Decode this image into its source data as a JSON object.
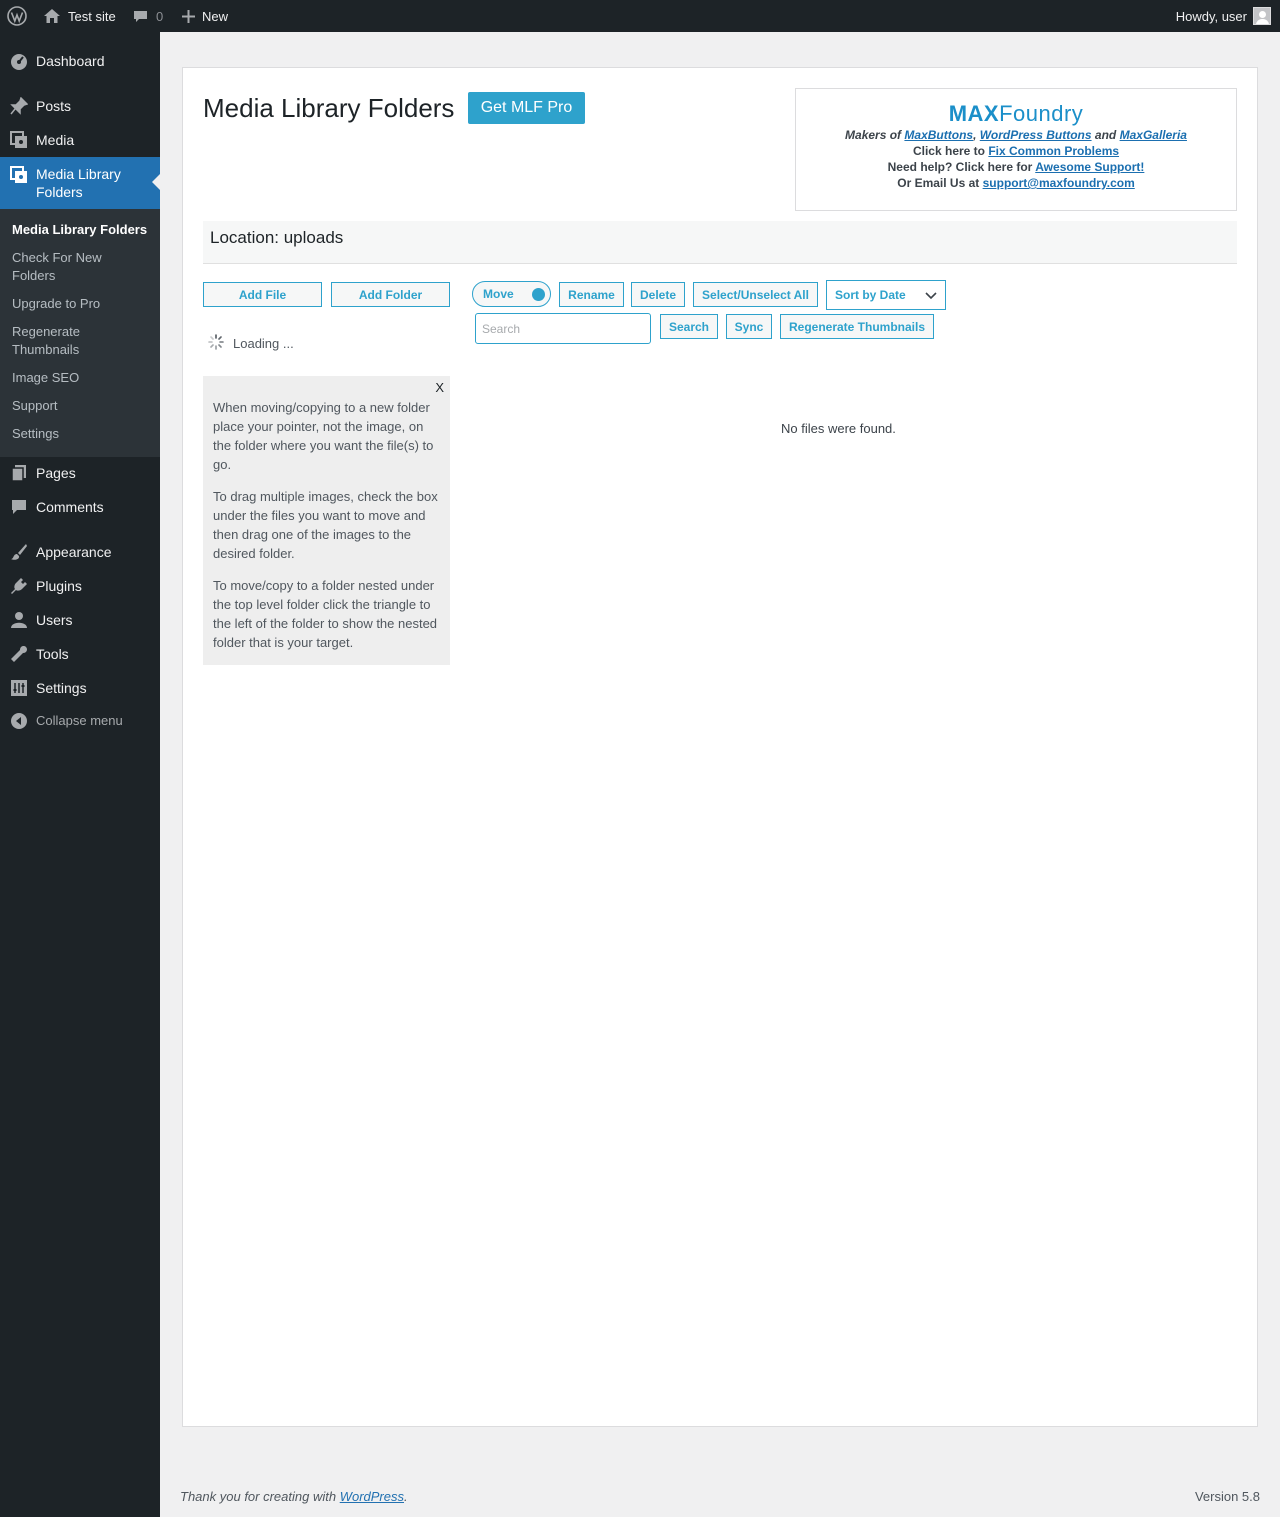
{
  "adminbar": {
    "site_name": "Test site",
    "comments_count": "0",
    "new_label": "New",
    "howdy": "Howdy, user"
  },
  "menu": {
    "dashboard": "Dashboard",
    "posts": "Posts",
    "media": "Media",
    "mlf": "Media Library Folders",
    "pages": "Pages",
    "comments": "Comments",
    "appearance": "Appearance",
    "plugins": "Plugins",
    "users": "Users",
    "tools": "Tools",
    "settings": "Settings",
    "collapse": "Collapse menu",
    "submenu": [
      "Media Library Folders",
      "Check For New Folders",
      "Upgrade to Pro",
      "Regenerate Thumbnails",
      "Image SEO",
      "Support",
      "Settings"
    ]
  },
  "page": {
    "title": "Media Library Folders",
    "get_pro": "Get MLF Pro",
    "location": "Location: uploads",
    "loading": "Loading ...",
    "no_files": "No files were found."
  },
  "maxbox": {
    "logo_max": "MAX",
    "logo_foundry": "Foundry",
    "makers_of": "Makers of",
    "link_maxbuttons": "MaxButtons",
    "comma": ",",
    "link_wpbuttons": "WordPress Buttons",
    "and": "and",
    "link_maxgalleria": "MaxGalleria",
    "click_here_to": "Click here to",
    "link_fix": "Fix Common Problems",
    "need_help": "Need help? Click here for",
    "link_support": "Awesome Support!",
    "email_us": "Or Email Us at",
    "link_email": "support@maxfoundry.com"
  },
  "toolbar": {
    "add_file": "Add File",
    "add_folder": "Add Folder",
    "move": "Move",
    "rename": "Rename",
    "delete": "Delete",
    "select_all": "Select/Unselect All",
    "sort": "Sort by Date",
    "search_placeholder": "Search",
    "search_button": "Search",
    "sync": "Sync",
    "regen": "Regenerate Thumbnails"
  },
  "help": {
    "close": "X",
    "p1": "When moving/copying to a new folder place your pointer, not the image, on the folder where you want the file(s) to go.",
    "p2": "To drag multiple images, check the box under the files you want to move and then drag one of the images to the desired folder.",
    "p3": "To move/copy to a folder nested under the top level folder click the triangle to the left of the folder to show the nested folder that is your target."
  },
  "footer": {
    "thanks_prefix": "Thank you for creating with",
    "wp_link": "WordPress",
    "thanks_suffix": ".",
    "version": "Version 5.8"
  },
  "colors": {
    "adminbar_bg": "#1d2327",
    "menu_current": "#2271b1",
    "accent": "#2ea2cc"
  }
}
